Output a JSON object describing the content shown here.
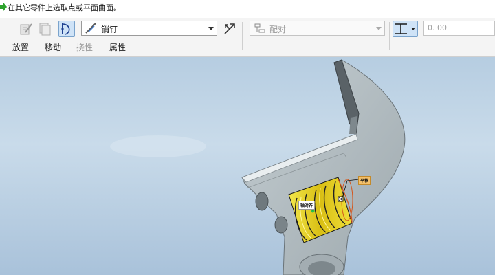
{
  "message": {
    "text": "在其它零件上选取点或平面曲面。"
  },
  "toolbar": {
    "buttons": [
      {
        "name": "edit-icon-button",
        "state": "disabled"
      },
      {
        "name": "copy-icon-button",
        "state": "disabled"
      },
      {
        "name": "constraint-display-button",
        "state": "active"
      }
    ],
    "connection_type": {
      "value": "销钉"
    },
    "flip_label": "",
    "constraint_type": {
      "value": "配对",
      "state": "disabled"
    },
    "offset_mode": {
      "state": "active"
    },
    "offset_value": "0. 00"
  },
  "tabs": [
    {
      "label": "放置",
      "enabled": true
    },
    {
      "label": "移动",
      "enabled": true
    },
    {
      "label": "挠性",
      "enabled": false
    },
    {
      "label": "属性",
      "enabled": true
    }
  ],
  "viewport": {
    "annotations": [
      {
        "label": "轴对齐"
      },
      {
        "label": "平移"
      }
    ],
    "colors": {
      "part": "#b4bfc4",
      "highlight": "#e6d21a",
      "background": "#bcd0e3"
    }
  }
}
